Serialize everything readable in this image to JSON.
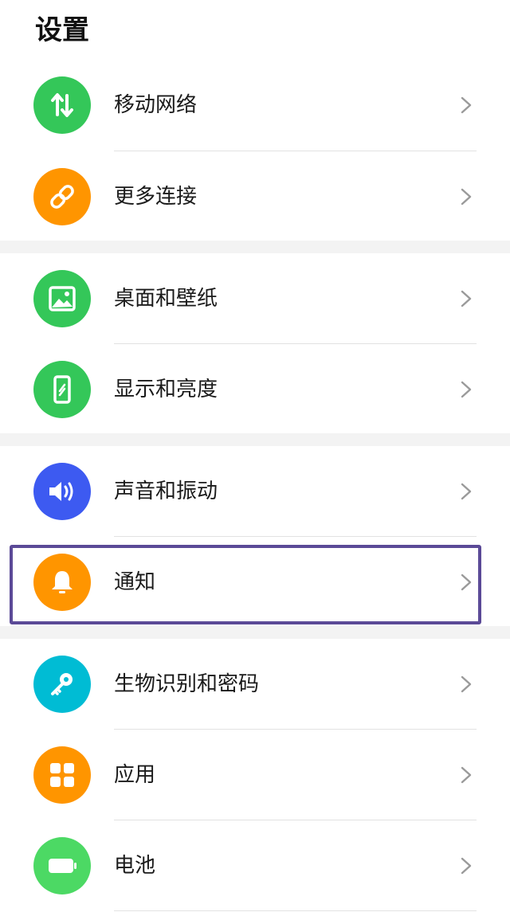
{
  "header": {
    "title": "设置"
  },
  "items": [
    {
      "label": "移动网络",
      "icon": "mobile-data-icon",
      "color": "#34c759"
    },
    {
      "label": "更多连接",
      "icon": "link-icon",
      "color": "#ff9500"
    },
    {
      "label": "桌面和壁纸",
      "icon": "image-icon",
      "color": "#34c759"
    },
    {
      "label": "显示和亮度",
      "icon": "phone-brightness-icon",
      "color": "#34c759"
    },
    {
      "label": "声音和振动",
      "icon": "speaker-icon",
      "color": "#3d5af1"
    },
    {
      "label": "通知",
      "icon": "bell-icon",
      "color": "#ff9500"
    },
    {
      "label": "生物识别和密码",
      "icon": "key-icon",
      "color": "#00bcd4"
    },
    {
      "label": "应用",
      "icon": "apps-grid-icon",
      "color": "#ff9500"
    },
    {
      "label": "电池",
      "icon": "battery-icon",
      "color": "#4cd964"
    }
  ],
  "colors": {
    "highlight_border": "#5b4a97",
    "group_gap": "#f3f3f3"
  }
}
